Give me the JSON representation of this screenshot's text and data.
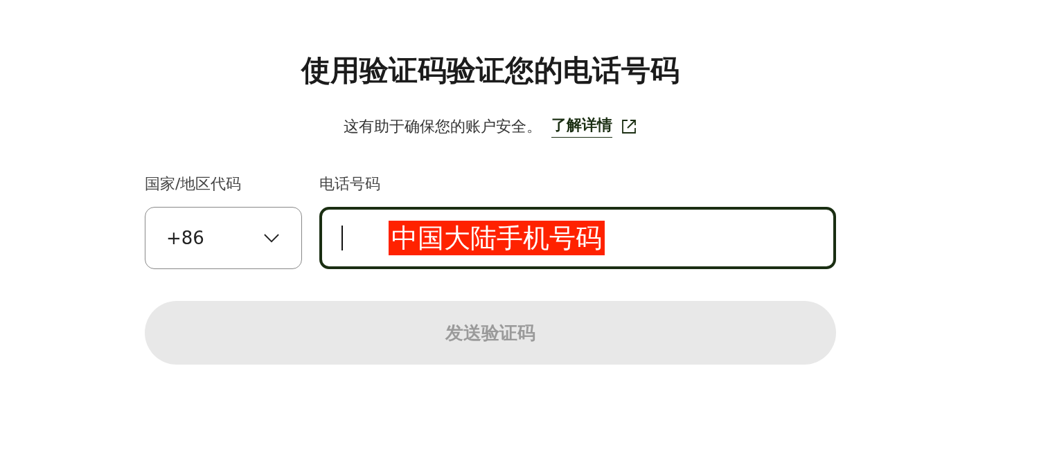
{
  "title": "使用验证码验证您的电话号码",
  "subtitle": {
    "text": "这有助于确保您的账户安全。",
    "link": "了解详情"
  },
  "country_field": {
    "label": "国家/地区代码",
    "value": "+86"
  },
  "phone_field": {
    "label": "电话号码",
    "focused": true,
    "annotation": "中国大陆手机号码"
  },
  "send_button": {
    "label": "发送验证码",
    "disabled": true
  }
}
